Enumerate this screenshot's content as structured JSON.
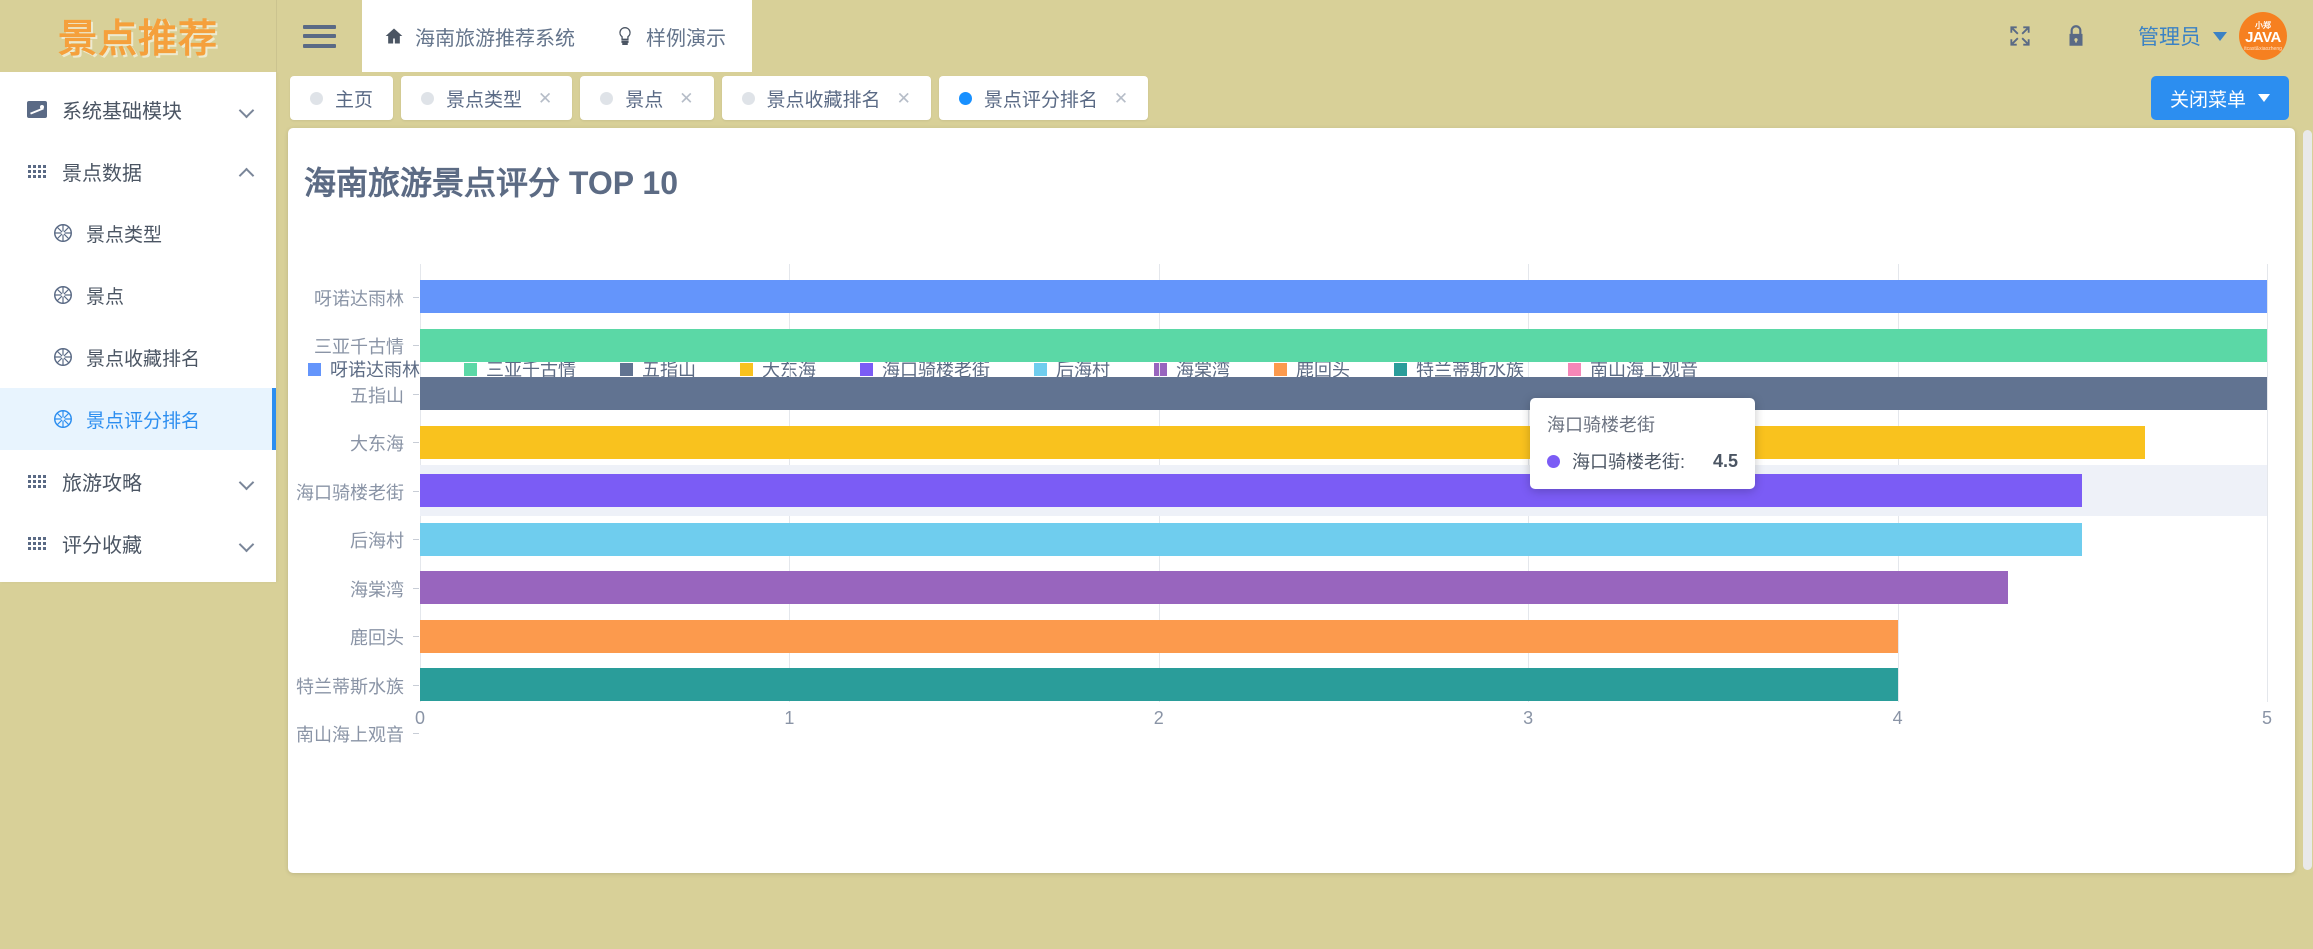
{
  "header": {
    "logo_text": "景点推荐",
    "menu_toggle_icon": "hamburger-icon",
    "nav": [
      {
        "icon": "home-icon",
        "label": "海南旅游推荐系统"
      },
      {
        "icon": "lightbulb-icon",
        "label": "样例演示"
      }
    ],
    "fullscreen_icon": "fullscreen-icon",
    "lock_icon": "lock-icon",
    "user_name": "管理员",
    "avatar": {
      "top": "小郑",
      "mid": "JAVA",
      "bottom": "itcast&xiaozheng"
    }
  },
  "sidebar": {
    "groups": [
      {
        "icon": "chart-icon",
        "label": "系统基础模块",
        "expanded": false,
        "chevron": "chevron-down-icon"
      },
      {
        "icon": "grid-icon",
        "label": "景点数据",
        "expanded": true,
        "chevron": "chevron-up-icon",
        "children": [
          {
            "icon": "aperture-icon",
            "label": "景点类型",
            "active": false
          },
          {
            "icon": "aperture-icon",
            "label": "景点",
            "active": false
          },
          {
            "icon": "aperture-icon",
            "label": "景点收藏排名",
            "active": false
          },
          {
            "icon": "aperture-icon",
            "label": "景点评分排名",
            "active": true
          }
        ]
      },
      {
        "icon": "grid-icon",
        "label": "旅游攻略",
        "expanded": false,
        "chevron": "chevron-down-icon"
      },
      {
        "icon": "grid-icon",
        "label": "评分收藏",
        "expanded": false,
        "chevron": "chevron-down-icon"
      }
    ]
  },
  "tabbar": {
    "tabs": [
      {
        "label": "主页",
        "active": false,
        "closable": false
      },
      {
        "label": "景点类型",
        "active": false,
        "closable": true
      },
      {
        "label": "景点",
        "active": false,
        "closable": true
      },
      {
        "label": "景点收藏排名",
        "active": false,
        "closable": true
      },
      {
        "label": "景点评分排名",
        "active": true,
        "closable": true
      }
    ],
    "close_menu_label": "关闭菜单",
    "close_symbol": "✕"
  },
  "tooltip": {
    "title": "海口骑楼老街",
    "series_name": "海口骑楼老街:",
    "value": "4.5",
    "color": "#7b5cf5"
  },
  "chart_data": {
    "type": "bar",
    "orientation": "horizontal",
    "title": "海南旅游景点评分 TOP 10",
    "xlabel": "",
    "ylabel": "",
    "xlim": [
      0,
      5
    ],
    "xticks": [
      "0",
      "1",
      "2",
      "3",
      "4",
      "5"
    ],
    "grid": true,
    "legend_position": "top-left",
    "categories": [
      "呀诺达雨林",
      "三亚千古情",
      "五指山",
      "大东海",
      "海口骑楼老街",
      "后海村",
      "海棠湾",
      "鹿回头",
      "特兰蒂斯水族",
      "南山海上观音"
    ],
    "values": [
      5,
      5,
      5,
      4.67,
      4.5,
      4.5,
      4.3,
      4,
      4,
      0
    ],
    "colors": [
      "#6495fb",
      "#5bd8a6",
      "#617391",
      "#f9c21e",
      "#7b5cf5",
      "#6fcdee",
      "#9865be",
      "#fc9a4d",
      "#2a9d9a",
      "#f587b8"
    ],
    "series": [
      {
        "name": "呀诺达雨林",
        "value": 5,
        "color": "#6495fb"
      },
      {
        "name": "三亚千古情",
        "value": 5,
        "color": "#5bd8a6"
      },
      {
        "name": "五指山",
        "value": 5,
        "color": "#617391"
      },
      {
        "name": "大东海",
        "value": 4.67,
        "color": "#f9c21e"
      },
      {
        "name": "海口骑楼老街",
        "value": 4.5,
        "color": "#7b5cf5"
      },
      {
        "name": "后海村",
        "value": 4.5,
        "color": "#6fcdee"
      },
      {
        "name": "海棠湾",
        "value": 4.3,
        "color": "#9865be"
      },
      {
        "name": "鹿回头",
        "value": 4,
        "color": "#fc9a4d"
      },
      {
        "name": "特兰蒂斯水族",
        "value": 4,
        "color": "#2a9d9a"
      },
      {
        "name": "南山海上观音",
        "value": 0,
        "color": "#f587b8"
      }
    ]
  },
  "theme": {
    "brand_khaki": "#d8d098",
    "accent_blue": "#2c8ef0",
    "logo_orange": "#f5a03c"
  }
}
